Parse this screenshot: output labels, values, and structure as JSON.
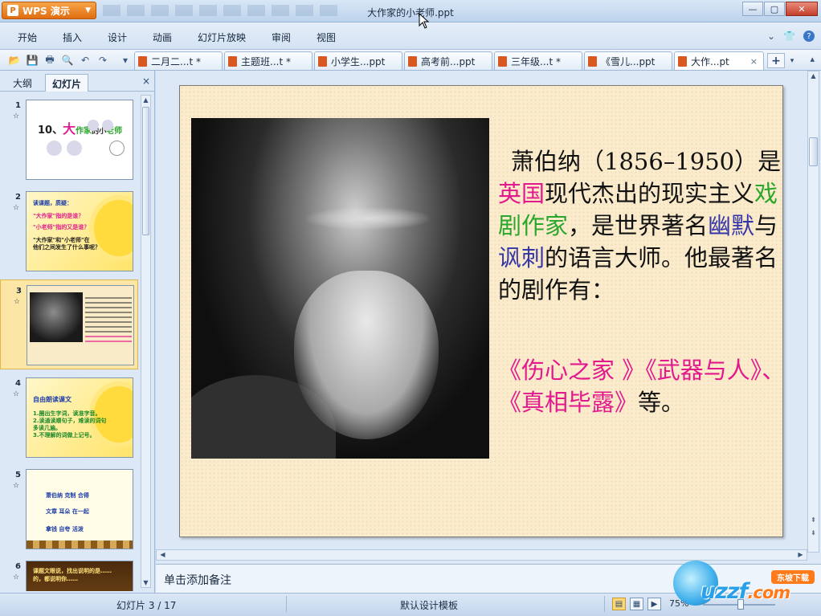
{
  "app": {
    "name": "WPS 演示",
    "logo_letter": "P"
  },
  "window": {
    "title": "大作家的小老师.ppt",
    "controls": [
      "—",
      "▢",
      "✕"
    ]
  },
  "menu": {
    "items": [
      "开始",
      "插入",
      "设计",
      "动画",
      "幻灯片放映",
      "审阅",
      "视图"
    ],
    "right_icons": [
      "chevron-down-icon",
      "shirt-icon",
      "help-icon"
    ],
    "help_label": "?"
  },
  "toolbar": {
    "doc_tabs": [
      {
        "label": "二月二...t *",
        "active": false
      },
      {
        "label": "主题班...t *",
        "active": false
      },
      {
        "label": "小学生...ppt",
        "active": false
      },
      {
        "label": "高考前...ppt",
        "active": false
      },
      {
        "label": "三年级...t *",
        "active": false
      },
      {
        "label": "《雪儿...ppt",
        "active": false
      },
      {
        "label": "大作...pt",
        "active": true
      }
    ],
    "add_tab": "+",
    "close_mark": "×"
  },
  "left_panel": {
    "tabs": [
      "大纲",
      "幻灯片"
    ],
    "close": "×",
    "thumbnails": [
      {
        "num": "1",
        "star": "☆",
        "title_a": "10、",
        "title_b": "大",
        "title_c": "作家",
        "title_d": "的小",
        "title_e": "老师"
      },
      {
        "num": "2",
        "star": "☆",
        "lines": [
          "读课题，质疑：",
          "\"大作家\"指的是谁？",
          "\"小老师\"指的又是谁？",
          "\"大作家\"和\"小老师\"在",
          "他们之间发生了什么事呢？"
        ]
      },
      {
        "num": "3",
        "star": "☆",
        "selected": true
      },
      {
        "num": "4",
        "star": "☆",
        "lines": [
          "自由朗读课文",
          "1.圈出生字词，读准字音。",
          "2.读通读顺句子，难读的词句",
          "多读几遍。",
          "3.不理解的词做上记号。"
        ]
      },
      {
        "num": "5",
        "star": "☆",
        "lines": [
          "萧伯纳  克制  合得",
          "文章  耳朵  在一起",
          "拿钱  自夸  活泼"
        ]
      },
      {
        "num": "6",
        "star": "☆",
        "lines": [
          "课题文眼说，找出说明的是……",
          "的，都说明你……"
        ]
      }
    ]
  },
  "slide": {
    "intro": {
      "name": "萧伯纳",
      "years": "（1856–1950）",
      "is": "是",
      "country": "英国",
      "desc1": "现代杰出的现实主义",
      "profession": "戏剧作家",
      "desc2": "，是世界著名",
      "humor": "幽默",
      "and": "与",
      "satire": "讽刺",
      "desc3": "的语言大师。他最著名的剧作有："
    },
    "works": {
      "w1": "《伤心之家 》",
      "w2": "《武器与人》",
      "sep": "、",
      "w3": "《真相毕露》",
      "end": "等。"
    }
  },
  "notes": {
    "placeholder": "单击添加备注"
  },
  "status": {
    "slide_info": "幻灯片 3 / 17",
    "template": "默认设计模板",
    "zoom": "75%"
  },
  "watermark": {
    "brand": "uzzf",
    "tld": ".com",
    "badge": "东坡下载"
  }
}
